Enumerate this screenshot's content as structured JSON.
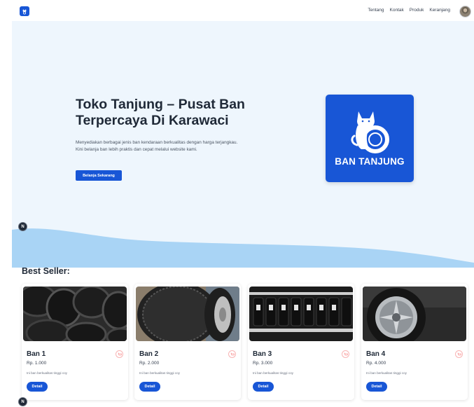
{
  "nav": {
    "links": [
      "Tentang",
      "Kontak",
      "Produk",
      "Keranjang"
    ]
  },
  "hero": {
    "title": "Toko Tanjung – Pusat Ban Terpercaya Di Karawaci",
    "description": "Menyediakan berbagai jenis ban kendaraan berkualitas dengan harga terjangkau. Kini belanja ban lebih praktis dan cepat melalui website kami.",
    "button_label": "Belanja Sekarang",
    "brand_text": "BAN TANJUNG"
  },
  "badges": {
    "n_label": "N"
  },
  "best_seller": {
    "title": "Best Seller:",
    "products": [
      {
        "name": "Ban 1",
        "price": "Rp. 1.000",
        "description": "Ini ban berkualitas tinggi coy",
        "button_label": "Detail"
      },
      {
        "name": "Ban 2",
        "price": "Rp. 2.000",
        "description": "Ini ban berkualitas tinggi coy",
        "button_label": "Detail"
      },
      {
        "name": "Ban 3",
        "price": "Rp. 3.000",
        "description": "Ini ban berkualitas tinggi coy",
        "button_label": "Detail"
      },
      {
        "name": "Ban 4",
        "price": "Rp. 4.000",
        "description": "Ini ban berkualitas tinggi coy",
        "button_label": "Detail"
      }
    ]
  },
  "colors": {
    "primary": "#1856d6",
    "hero_background": "#eef6fd",
    "wave": "#a9d4f5"
  },
  "icons": [
    "logo-icon",
    "avatar",
    "cart-icon",
    "cat-tire-logo"
  ]
}
